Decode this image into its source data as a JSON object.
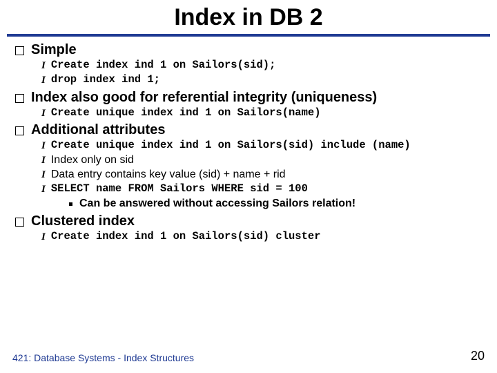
{
  "title": "Index in DB 2",
  "sections": [
    {
      "heading": "Simple",
      "items": [
        {
          "style": "mono",
          "text": "Create index ind 1 on Sailors(sid);"
        },
        {
          "style": "mono",
          "text": "drop index ind 1;"
        }
      ]
    },
    {
      "heading": "Index also good for referential integrity (uniqueness)",
      "items": [
        {
          "style": "mono",
          "text": "Create unique index ind 1 on Sailors(name)"
        }
      ]
    },
    {
      "heading": "Additional attributes",
      "items": [
        {
          "style": "mono",
          "text": "Create unique index ind 1 on Sailors(sid) include (name)"
        },
        {
          "style": "comic",
          "text": "Index only on sid"
        },
        {
          "style": "comic",
          "text": "Data entry contains key value (sid) + name + rid"
        },
        {
          "style": "mono",
          "text": "SELECT name FROM Sailors WHERE sid = 100",
          "sub": [
            {
              "style": "comicbold",
              "text": "Can be answered without accessing Sailors relation!"
            }
          ]
        }
      ]
    },
    {
      "heading": "Clustered index",
      "items": [
        {
          "style": "mono",
          "text": "Create index ind 1 on Sailors(sid) cluster"
        }
      ]
    }
  ],
  "footer_left": "421: Database Systems - Index Structures",
  "footer_right": "20"
}
